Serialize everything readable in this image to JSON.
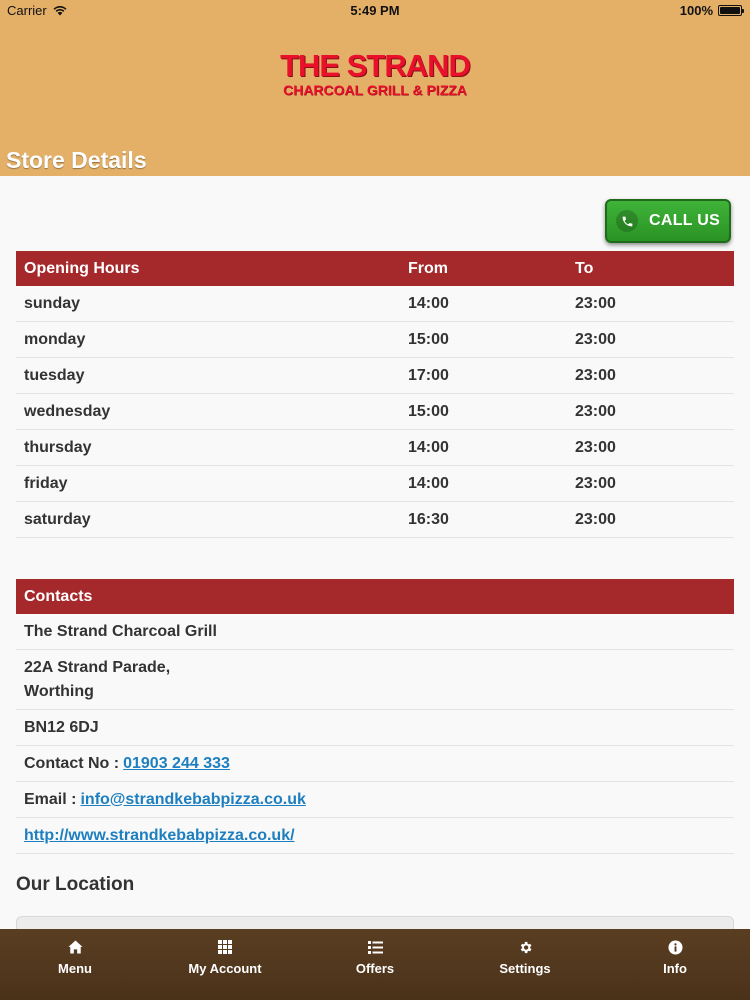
{
  "status_bar": {
    "carrier": "Carrier",
    "time": "5:49 PM",
    "battery": "100%"
  },
  "brand": {
    "name": "THE STRAND",
    "tagline": "CHARCOAL GRILL & PIZZA"
  },
  "page": {
    "title": "Store Details"
  },
  "call_button": {
    "label": "CALL US"
  },
  "opening_hours": {
    "headers": {
      "day": "Opening Hours",
      "from": "From",
      "to": "To"
    },
    "rows": [
      {
        "day": "sunday",
        "from": "14:00",
        "to": "23:00"
      },
      {
        "day": "monday",
        "from": "15:00",
        "to": "23:00"
      },
      {
        "day": "tuesday",
        "from": "17:00",
        "to": "23:00"
      },
      {
        "day": "wednesday",
        "from": "15:00",
        "to": "23:00"
      },
      {
        "day": "thursday",
        "from": "14:00",
        "to": "23:00"
      },
      {
        "day": "friday",
        "from": "14:00",
        "to": "23:00"
      },
      {
        "day": "saturday",
        "from": "16:30",
        "to": "23:00"
      }
    ]
  },
  "contacts": {
    "title": "Contacts",
    "business_name": "The Strand Charcoal Grill",
    "address_line1": "22A Strand Parade,",
    "address_line2": "Worthing",
    "postcode": "BN12 6DJ",
    "phone_label": "Contact No :",
    "phone": "01903 244 333",
    "email_label": "Email :",
    "email": "info@strandkebabpizza.co.uk",
    "website": "http://www.strandkebabpizza.co.uk/"
  },
  "location": {
    "title": "Our Location"
  },
  "nav": {
    "items": [
      {
        "label": "Menu",
        "icon": "home-icon"
      },
      {
        "label": "My Account",
        "icon": "grid-icon"
      },
      {
        "label": "Offers",
        "icon": "list-icon"
      },
      {
        "label": "Settings",
        "icon": "gear-icon"
      },
      {
        "label": "Info",
        "icon": "info-icon"
      }
    ]
  },
  "colors": {
    "header_bg": "#e4b068",
    "brand_red": "#e8102a",
    "table_header": "#a5282b",
    "call_green": "#2a9323",
    "link_blue": "#1d7fbf",
    "nav_bg": "#4f361e"
  }
}
